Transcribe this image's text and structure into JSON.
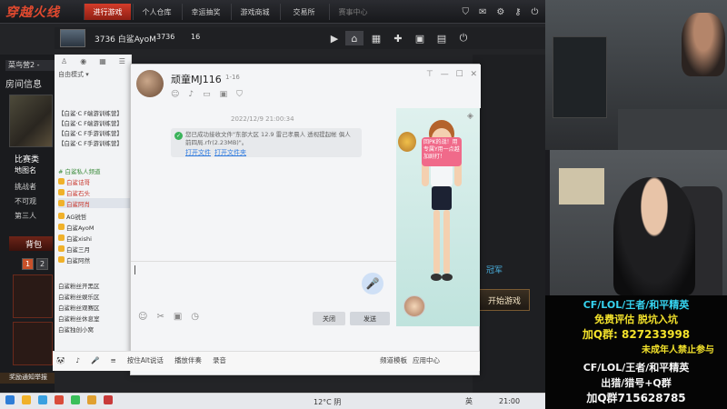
{
  "game": {
    "logo": "穿越火线",
    "tabs": [
      "进行游戏",
      "个人仓库",
      "幸运抽奖",
      "游戏商城",
      "交易所",
      "赛事中心"
    ],
    "active_tab": 0,
    "player": {
      "name": "3736 白鲨AyoM",
      "level": "3736",
      "num": "16"
    },
    "channel": "菜鸟营2 -",
    "room_info": "房间信息",
    "left_texts": [
      "比赛类",
      "地图名",
      "挑战者",
      "不可观",
      "第三人"
    ],
    "bag_label": "背包",
    "pages": [
      "1",
      "2"
    ],
    "report": "奖励通知举报",
    "start_button": "开始游戏",
    "brand": "冠军"
  },
  "qq_list": {
    "mode": "自由模式 ▾",
    "items": [
      "【白鲨·C F端游训练营】",
      "【白鲨·C F端游训练营】",
      "【白鲨·C F手游训练营】",
      "【白鲨·C F手游训练营】",
      "# 白鲨私人频道",
      "白鲨诘哥",
      "白鲨石头",
      "白鲨阿肖",
      "AG锐哲",
      "白鲨AyoM",
      "白鲨xishi",
      "白鲨三月",
      "白鲨阿然",
      "白鲨粉丝开黑区",
      "白鲨粉丝娱乐区",
      "白鲨粉丝观赛区",
      "白鲨粉丝休息室",
      "白鲨独创小窝"
    ],
    "selected": 7
  },
  "chat": {
    "name": "顽童MJ116",
    "sub": "1-16",
    "date": "2022/12/9 21:00:34",
    "file_text": "您已成功接收文件\"东部大区 12.9 雷己孝晨人 透视提起帐 俱人 前四局.rfr(2.23MB)\"。",
    "open_file": "打开文件",
    "open_folder": "打开文件夹",
    "bubble": "回PK的战！用专属Y用一点越加剧打！",
    "close_label": "关闭",
    "send_label": "发送",
    "status_items": [
      "按住Alt说话",
      "播放伴奏",
      "录音"
    ],
    "status_right": [
      "频道模板",
      "应用中心"
    ]
  },
  "taskbar": {
    "weather": "12°C 阴",
    "lang": "英",
    "time": "21:00"
  },
  "overlay": {
    "line1": "CF/LOL/王者/和平精英",
    "line2": "免费评估   脱坑入坑",
    "line3": "加Q群: 827233998",
    "line4": "未成年人禁止参与",
    "line5": "CF/LOL/王者/和平精英",
    "line6": "出猎/猎号+Q群",
    "line7": "加Q群715628785"
  },
  "colors": {
    "accent": "#d43c2a",
    "cyan": "#36d4f0",
    "yellow": "#f3e22b",
    "send_blue": "#3a7de0"
  }
}
